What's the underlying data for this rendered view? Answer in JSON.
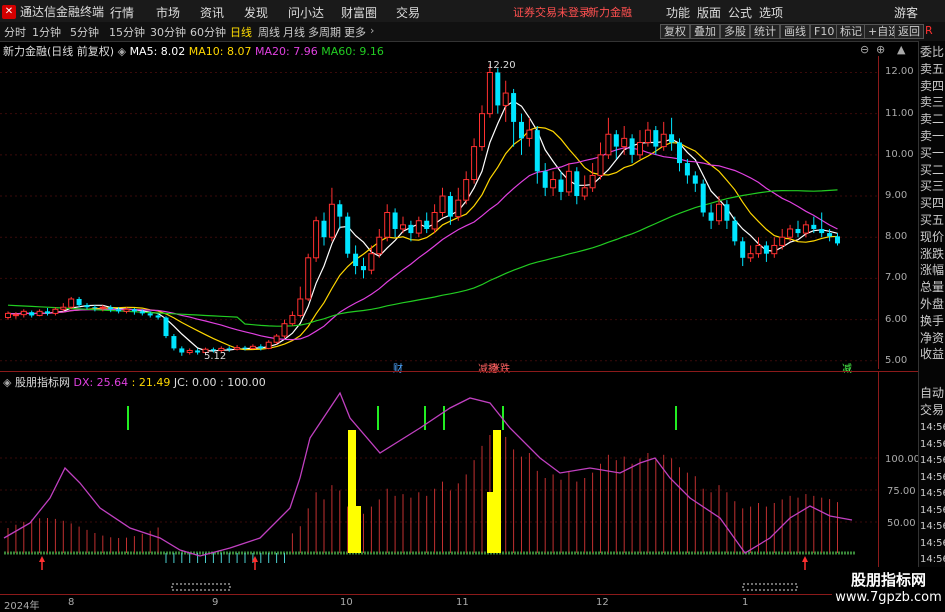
{
  "window": {
    "title": "通达信金融终端",
    "menu": [
      "行情",
      "市场",
      "资讯",
      "发现",
      "问小达",
      "财富圈",
      "交易"
    ],
    "notice": "证券交易未登录",
    "notice2": "新力金融",
    "right_menu": [
      "功能",
      "版面",
      "公式",
      "选项"
    ],
    "guest": "游客",
    "r_icon": "R"
  },
  "toolbar": {
    "periods": [
      "分时",
      "1分钟",
      "5分钟",
      "15分钟",
      "30分钟",
      "60分钟",
      "日线",
      "周线",
      "月线",
      "多周期",
      "更多"
    ],
    "active": "日线",
    "right_buttons": [
      "复权",
      "叠加",
      "多股",
      "统计",
      "画线",
      "F10",
      "标记",
      "+自选",
      "返回"
    ]
  },
  "main_legend": {
    "name": "新力金融(日线 前复权)",
    "ma5": "MA5: 8.02",
    "ma10": "MA10: 8.07",
    "ma20": "MA20: 7.96",
    "ma60": "MA60: 9.16"
  },
  "indicator_legend": {
    "name": "股朋指标网",
    "dx": "DX: 25.64",
    "v2": ": 21.49",
    "jc": "JC: 0.00",
    "v4": ": 100.00"
  },
  "colors": {
    "up": "#ff3030",
    "down": "#00e5ff",
    "ma5": "#ffffff",
    "ma10": "#ffd700",
    "ma20": "#e040e0",
    "ma60": "#22cc22",
    "bar_yellow": "#ffff00"
  },
  "price_axis": [
    "12.00",
    "11.00",
    "10.00",
    "9.00",
    "8.00",
    "7.00",
    "6.00",
    "5.00"
  ],
  "ind_axis": [
    "100.00",
    "75.00",
    "50.00"
  ],
  "annotations": {
    "high": "12.20",
    "low": "5.12",
    "tag1": "财",
    "tag2": "减持",
    "tag3": "涨跌",
    "tag4": "减"
  },
  "date_axis": [
    "2024年",
    "8",
    "9",
    "10",
    "11",
    "12",
    "1"
  ],
  "right_panel": [
    "委比",
    "卖五",
    "卖四",
    "卖三",
    "卖二",
    "卖一",
    "买一",
    "买二",
    "买三",
    "买四",
    "买五",
    "现价",
    "涨跌",
    "涨幅",
    "总量",
    "外盘",
    "换手",
    "净资",
    "收益"
  ],
  "right_panel_lower": [
    "自动",
    "交易"
  ],
  "time_labels": [
    "14:56",
    "14:56",
    "14:56",
    "14:56",
    "14:56",
    "14:56",
    "14:56",
    "14:56",
    "14:56",
    "14:56"
  ],
  "watermark": {
    "line1": "股朋指标网",
    "line2": "www.7gpzb.com"
  },
  "chart_data": {
    "type": "candlestick",
    "ylim": [
      4.8,
      12.4
    ],
    "candles": [
      [
        6.05,
        6.15,
        6.2,
        6.0
      ],
      [
        6.1,
        6.12,
        6.18,
        6.02
      ],
      [
        6.12,
        6.2,
        6.25,
        6.05
      ],
      [
        6.18,
        6.1,
        6.22,
        6.05
      ],
      [
        6.1,
        6.2,
        6.25,
        6.08
      ],
      [
        6.2,
        6.15,
        6.28,
        6.1
      ],
      [
        6.15,
        6.25,
        6.3,
        6.1
      ],
      [
        6.25,
        6.3,
        6.4,
        6.2
      ],
      [
        6.3,
        6.5,
        6.55,
        6.25
      ],
      [
        6.5,
        6.35,
        6.55,
        6.3
      ],
      [
        6.35,
        6.3,
        6.4,
        6.25
      ],
      [
        6.3,
        6.28,
        6.35,
        6.2
      ],
      [
        6.28,
        6.3,
        6.35,
        6.2
      ],
      [
        6.3,
        6.25,
        6.35,
        6.18
      ],
      [
        6.25,
        6.2,
        6.3,
        6.15
      ],
      [
        6.2,
        6.25,
        6.3,
        6.15
      ],
      [
        6.25,
        6.2,
        6.28,
        6.12
      ],
      [
        6.2,
        6.15,
        6.25,
        6.1
      ],
      [
        6.15,
        6.1,
        6.2,
        6.05
      ],
      [
        6.1,
        6.05,
        6.15,
        6.0
      ],
      [
        6.05,
        5.6,
        6.08,
        5.55
      ],
      [
        5.6,
        5.3,
        5.65,
        5.25
      ],
      [
        5.3,
        5.2,
        5.35,
        5.12
      ],
      [
        5.2,
        5.25,
        5.3,
        5.15
      ],
      [
        5.25,
        5.2,
        5.3,
        5.15
      ],
      [
        5.2,
        5.28,
        5.32,
        5.15
      ],
      [
        5.28,
        5.25,
        5.32,
        5.2
      ],
      [
        5.25,
        5.3,
        5.35,
        5.2
      ],
      [
        5.3,
        5.28,
        5.35,
        5.22
      ],
      [
        5.28,
        5.32,
        5.38,
        5.25
      ],
      [
        5.32,
        5.3,
        5.36,
        5.25
      ],
      [
        5.3,
        5.35,
        5.4,
        5.28
      ],
      [
        5.35,
        5.3,
        5.4,
        5.25
      ],
      [
        5.3,
        5.45,
        5.5,
        5.28
      ],
      [
        5.45,
        5.6,
        5.65,
        5.4
      ],
      [
        5.6,
        5.9,
        6.0,
        5.55
      ],
      [
        5.9,
        6.1,
        6.2,
        5.85
      ],
      [
        6.1,
        6.5,
        6.8,
        6.05
      ],
      [
        6.5,
        7.5,
        7.6,
        6.45
      ],
      [
        7.5,
        8.4,
        8.5,
        7.4
      ],
      [
        8.4,
        8.0,
        8.6,
        7.8
      ],
      [
        8.0,
        8.8,
        9.2,
        7.9
      ],
      [
        8.8,
        8.5,
        8.9,
        8.2
      ],
      [
        8.5,
        7.6,
        8.6,
        7.5
      ],
      [
        7.6,
        7.3,
        7.8,
        7.1
      ],
      [
        7.3,
        7.2,
        7.5,
        7.0
      ],
      [
        7.2,
        7.6,
        7.8,
        7.1
      ],
      [
        7.6,
        8.0,
        8.2,
        7.5
      ],
      [
        8.0,
        8.6,
        8.8,
        7.9
      ],
      [
        8.6,
        8.2,
        8.7,
        8.0
      ],
      [
        8.2,
        8.3,
        8.5,
        8.1
      ],
      [
        8.3,
        8.1,
        8.4,
        7.9
      ],
      [
        8.1,
        8.4,
        8.5,
        8.0
      ],
      [
        8.4,
        8.2,
        8.6,
        8.1
      ],
      [
        8.2,
        8.6,
        8.8,
        8.1
      ],
      [
        8.6,
        9.0,
        9.2,
        8.5
      ],
      [
        9.0,
        8.5,
        9.1,
        8.3
      ],
      [
        8.5,
        8.9,
        9.2,
        8.4
      ],
      [
        8.9,
        9.4,
        9.6,
        8.8
      ],
      [
        9.4,
        10.2,
        10.4,
        9.3
      ],
      [
        10.2,
        11.0,
        11.2,
        10.1
      ],
      [
        11.0,
        12.0,
        12.2,
        10.9
      ],
      [
        12.0,
        11.2,
        12.1,
        11.0
      ],
      [
        11.2,
        11.5,
        11.8,
        10.8
      ],
      [
        11.5,
        10.8,
        11.6,
        10.2
      ],
      [
        10.8,
        10.4,
        11.0,
        10.0
      ],
      [
        10.4,
        10.6,
        10.9,
        10.2
      ],
      [
        10.6,
        9.6,
        10.7,
        9.3
      ],
      [
        9.6,
        9.2,
        9.8,
        9.0
      ],
      [
        9.2,
        9.4,
        9.6,
        9.0
      ],
      [
        9.4,
        9.1,
        9.6,
        8.9
      ],
      [
        9.1,
        9.6,
        9.8,
        9.0
      ],
      [
        9.6,
        9.0,
        9.7,
        8.8
      ],
      [
        9.0,
        9.2,
        9.5,
        8.9
      ],
      [
        9.2,
        9.5,
        9.8,
        9.1
      ],
      [
        9.5,
        10.0,
        10.3,
        9.4
      ],
      [
        10.0,
        10.5,
        10.9,
        9.9
      ],
      [
        10.5,
        10.2,
        10.6,
        9.9
      ],
      [
        10.2,
        10.4,
        10.7,
        10.0
      ],
      [
        10.4,
        10.0,
        10.5,
        9.8
      ],
      [
        10.0,
        10.3,
        10.6,
        9.9
      ],
      [
        10.3,
        10.6,
        10.8,
        10.2
      ],
      [
        10.6,
        10.2,
        10.7,
        10.0
      ],
      [
        10.2,
        10.5,
        10.8,
        10.1
      ],
      [
        10.5,
        10.3,
        10.9,
        10.1
      ],
      [
        10.3,
        9.8,
        10.4,
        9.6
      ],
      [
        9.8,
        9.5,
        9.9,
        9.3
      ],
      [
        9.5,
        9.3,
        9.6,
        9.1
      ],
      [
        9.3,
        8.6,
        9.4,
        8.5
      ],
      [
        8.6,
        8.4,
        8.8,
        8.2
      ],
      [
        8.4,
        8.8,
        9.0,
        8.3
      ],
      [
        8.8,
        8.4,
        8.9,
        8.2
      ],
      [
        8.4,
        7.9,
        8.5,
        7.8
      ],
      [
        7.9,
        7.5,
        8.0,
        7.3
      ],
      [
        7.5,
        7.6,
        7.8,
        7.4
      ],
      [
        7.6,
        7.8,
        8.0,
        7.5
      ],
      [
        7.8,
        7.6,
        7.9,
        7.4
      ],
      [
        7.6,
        7.8,
        8.0,
        7.5
      ],
      [
        7.8,
        8.0,
        8.2,
        7.7
      ],
      [
        8.0,
        8.2,
        8.3,
        7.9
      ],
      [
        8.2,
        8.1,
        8.4,
        8.0
      ],
      [
        8.1,
        8.3,
        8.4,
        8.0
      ],
      [
        8.3,
        8.2,
        8.5,
        8.1
      ],
      [
        8.2,
        8.1,
        8.6,
        8.0
      ],
      [
        8.1,
        8.02,
        8.2,
        7.9
      ],
      [
        8.02,
        7.85,
        8.1,
        7.8
      ]
    ]
  }
}
